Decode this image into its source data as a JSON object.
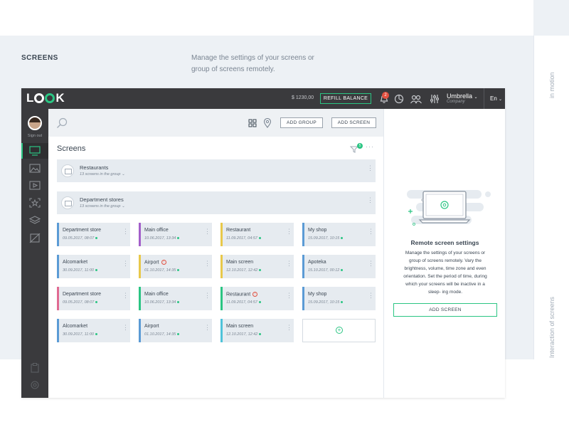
{
  "header": {
    "section_title": "SCREENS",
    "description": "Manage the settings of your screens or group of screens remotely."
  },
  "side_labels": {
    "top": "in motion",
    "bottom": "Interaction of screens"
  },
  "app": {
    "logo": "LOOK",
    "balance": "$ 1230,00",
    "refill_label": "REFILL BALANCE",
    "notifications": "2",
    "company_name": "Umbrella",
    "company_label": "Company",
    "language": "En",
    "sign_out": "Sign out",
    "toolbar": {
      "add_group": "ADD GROUP",
      "add_screen": "ADD SCREEN"
    },
    "screens_title": "Screens",
    "filter_count": "5",
    "groups": [
      {
        "name": "Restaurants",
        "sub": "13 screens in the group"
      },
      {
        "name": "Department stores",
        "sub": "13 screens in the group"
      }
    ],
    "cards": [
      {
        "name": "Department store",
        "date": "09.05.2017, 08:07",
        "color": "#5b9bd5",
        "warn": false
      },
      {
        "name": "Main office",
        "date": "10.06.2017, 13:34",
        "color": "#a35fc9",
        "warn": false
      },
      {
        "name": "Restaurant",
        "date": "11.09.2017, 04:57",
        "color": "#e8c84a",
        "warn": false
      },
      {
        "name": "My shop",
        "date": "15.09.2017, 10:15",
        "color": "#5b9bd5",
        "warn": false
      },
      {
        "name": "Alcomarket",
        "date": "30.09.2017, 11:00",
        "color": "#5b9bd5",
        "warn": false
      },
      {
        "name": "Airport",
        "date": "01.10.2017, 14:35",
        "color": "#e8c84a",
        "warn": true
      },
      {
        "name": "Main screen",
        "date": "12.10.2017, 12:42",
        "color": "#e8c84a",
        "warn": false
      },
      {
        "name": "Apoteka",
        "date": "15.10.2017, 00:12",
        "color": "#5b9bd5",
        "warn": false
      },
      {
        "name": "Department store",
        "date": "09.05.2017, 08:07",
        "color": "#e06a92",
        "warn": false
      },
      {
        "name": "Main office",
        "date": "10.06.2017, 13:34",
        "color": "#2bc583",
        "warn": false
      },
      {
        "name": "Restaurant",
        "date": "11.09.2017, 04:57",
        "color": "#2bc583",
        "warn": true
      },
      {
        "name": "My shop",
        "date": "15.09.2017, 10:15",
        "color": "#5b9bd5",
        "warn": false
      },
      {
        "name": "Alcomarket",
        "date": "30.09.2017, 11:00",
        "color": "#5b9bd5",
        "warn": false
      },
      {
        "name": "Airport",
        "date": "01.10.2017, 14:35",
        "color": "#5b9bd5",
        "warn": false
      },
      {
        "name": "Main screen",
        "date": "12.10.2017, 12:42",
        "color": "#4fc3d9",
        "warn": false
      }
    ],
    "add_card_icon": "+",
    "right_panel": {
      "title": "Remote screen settings",
      "description": "Manage the settings of your screens or group of screens remotely. Vary the brightness, volume, time zone and even orientation. Set the period of time, during which your screens will be inactive in a sleep- ing mode.",
      "button": "ADD SCREEN"
    },
    "accent_color": "#2bc583",
    "topbar_color": "#3a3a3d"
  }
}
